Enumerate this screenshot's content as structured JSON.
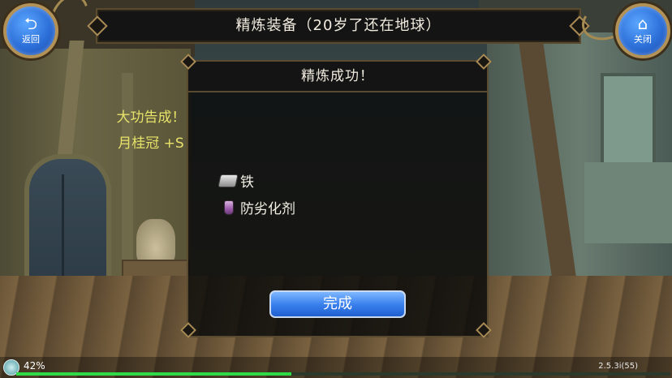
{
  "header": {
    "title": "精炼装备（20岁了还在地球）"
  },
  "buttons": {
    "back": {
      "icon": "back-arrow-icon",
      "glyph": "⮌",
      "label": "返回"
    },
    "close": {
      "icon": "home-icon",
      "glyph": "⌂",
      "label": "关闭"
    }
  },
  "dialog": {
    "title": "精炼成功！",
    "message": "大功告成！",
    "result_item": "月桂冠 +S",
    "message_color": "#e7e36a",
    "materials": [
      {
        "icon": "iron-ingot-icon",
        "label": "铁"
      },
      {
        "icon": "potion-bottle-icon",
        "label": "防劣化剂"
      }
    ],
    "confirm_label": "完成"
  },
  "status": {
    "percent_text": "42%",
    "progress_fraction": 0.42,
    "progress_color": "#2edb47",
    "version": "2.5.3i(55)"
  }
}
